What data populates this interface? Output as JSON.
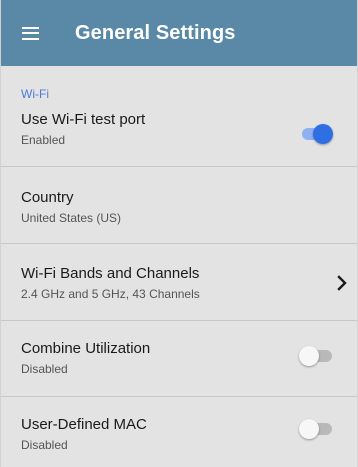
{
  "header": {
    "title": "General Settings"
  },
  "section": {
    "header": "Wi-Fi"
  },
  "settings": [
    {
      "title": "Use Wi-Fi test port",
      "value": "Enabled",
      "control": "switch",
      "checked": true
    },
    {
      "title": "Country",
      "value": "United States (US)",
      "control": "none"
    },
    {
      "title": "Wi-Fi Bands and Channels",
      "value": "2.4 GHz and 5 GHz, 43 Channels",
      "control": "chevron-right-icon"
    },
    {
      "title": "Combine Utilization",
      "value": "Disabled",
      "control": "switch",
      "checked": false
    },
    {
      "title": "User-Defined MAC",
      "value": "Disabled",
      "control": "switch",
      "checked": false
    }
  ],
  "colors": {
    "appbar": "#5a89a8",
    "section_header": "#4a7bd8",
    "switch_on": "#2f6fe4",
    "background": "#e3e3e3"
  },
  "icons": {
    "menu": "hamburger-menu-icon",
    "chevron": "chevron-right-icon"
  }
}
